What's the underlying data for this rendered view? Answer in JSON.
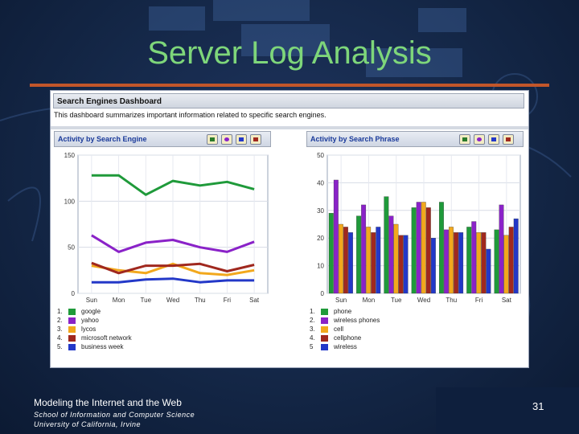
{
  "slide": {
    "title": "Server Log Analysis",
    "footer_line1": "Modeling the Internet and the Web",
    "footer_line2": "School of Information and Computer Science",
    "footer_line3": "University of California, Irvine",
    "page_number": "31"
  },
  "dashboard": {
    "title": "Search Engines Dashboard",
    "description": "This dashboard summarizes important information related to specific search engines."
  },
  "colors": {
    "title_green": "#7ed67a",
    "rule_orange": "#c2562a",
    "background": "#142747"
  },
  "left_chart": {
    "title": "Activity by Search Engine",
    "legend": [
      {
        "num": "1.",
        "label": "google",
        "color": "#1f9a3a"
      },
      {
        "num": "2.",
        "label": "yahoo",
        "color": "#8a22c8"
      },
      {
        "num": "3.",
        "label": "lycos",
        "color": "#f2a81d"
      },
      {
        "num": "4.",
        "label": "microsoft network",
        "color": "#a0281e"
      },
      {
        "num": "5.",
        "label": "business week",
        "color": "#2338c8"
      }
    ]
  },
  "right_chart": {
    "title": "Activity by Search Phrase",
    "legend": [
      {
        "num": "1.",
        "label": "phone",
        "color": "#1f9a3a"
      },
      {
        "num": "2.",
        "label": "wireless phones",
        "color": "#8a22c8"
      },
      {
        "num": "3.",
        "label": "cell",
        "color": "#f2a81d"
      },
      {
        "num": "4.",
        "label": "cellphone",
        "color": "#a0281e"
      },
      {
        "num": "5",
        "label": "wireless",
        "color": "#2338c8"
      }
    ]
  },
  "chart_data": [
    {
      "type": "line",
      "title": "Activity by Search Engine",
      "x": [
        "Sun",
        "Mon",
        "Tue",
        "Wed",
        "Thu",
        "Fri",
        "Sat"
      ],
      "ylim": [
        0,
        150
      ],
      "yticks": [
        "0",
        "50",
        "100",
        "150"
      ],
      "grid": true,
      "legend_position": "below",
      "series": [
        {
          "name": "google",
          "color": "#1f9a3a",
          "values": [
            128,
            128,
            107,
            122,
            117,
            121,
            113
          ]
        },
        {
          "name": "yahoo",
          "color": "#8a22c8",
          "values": [
            63,
            45,
            55,
            58,
            50,
            45,
            56
          ]
        },
        {
          "name": "lycos",
          "color": "#f2a81d",
          "values": [
            30,
            25,
            22,
            32,
            22,
            20,
            25
          ]
        },
        {
          "name": "microsoft network",
          "color": "#a0281e",
          "values": [
            33,
            22,
            30,
            30,
            32,
            24,
            31
          ]
        },
        {
          "name": "business week",
          "color": "#2338c8",
          "values": [
            12,
            12,
            15,
            16,
            12,
            14,
            14
          ]
        }
      ]
    },
    {
      "type": "bar",
      "title": "Activity by Search Phrase",
      "categories": [
        "Sun",
        "Mon",
        "Tue",
        "Wed",
        "Thu",
        "Fri",
        "Sat"
      ],
      "ylim": [
        0,
        50
      ],
      "yticks": [
        "0",
        "10",
        "20",
        "30",
        "40",
        "50"
      ],
      "grid": true,
      "legend_position": "below",
      "series": [
        {
          "name": "phone",
          "color": "#1f9a3a",
          "values": [
            29,
            28,
            35,
            31,
            33,
            24,
            23
          ]
        },
        {
          "name": "wireless phones",
          "color": "#8a22c8",
          "values": [
            41,
            32,
            28,
            33,
            23,
            26,
            32
          ]
        },
        {
          "name": "cell",
          "color": "#f2a81d",
          "values": [
            25,
            24,
            25,
            33,
            24,
            22,
            21
          ]
        },
        {
          "name": "cellphone",
          "color": "#a0281e",
          "values": [
            24,
            22,
            21,
            31,
            22,
            22,
            24
          ]
        },
        {
          "name": "wireless",
          "color": "#2338c8",
          "values": [
            22,
            24,
            21,
            20,
            22,
            16,
            27
          ]
        }
      ]
    }
  ]
}
